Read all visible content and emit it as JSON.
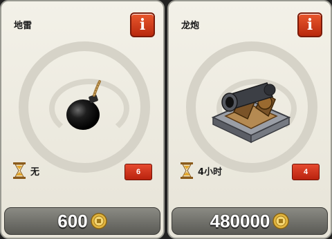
{
  "cards": [
    {
      "title": "地雷",
      "info_label": "i",
      "time": "无",
      "count": "6",
      "price": "600",
      "art_icon": "bomb-icon"
    },
    {
      "title": "龙炮",
      "info_label": "i",
      "time": "4小时",
      "count": "4",
      "price": "480000",
      "art_icon": "cannon-icon"
    }
  ],
  "colors": {
    "info_button": "#c8371a",
    "count_badge": "#d1351f",
    "coin": "#e3b640"
  }
}
